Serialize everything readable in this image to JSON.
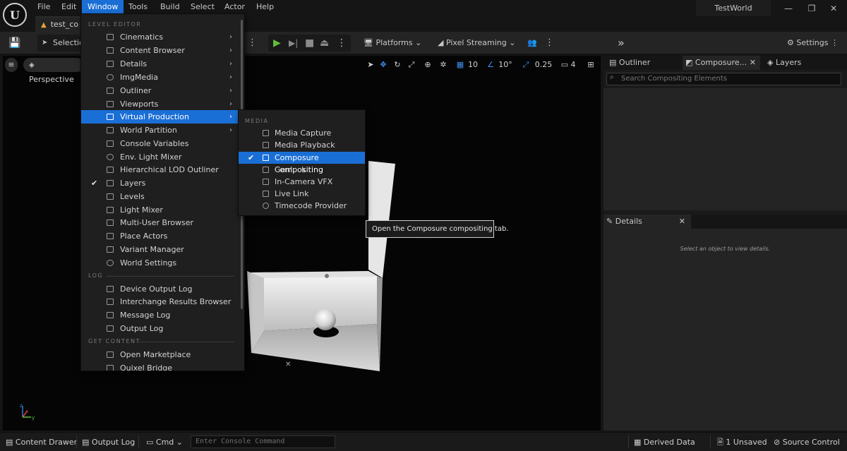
{
  "titlebar": {
    "logo": "U",
    "menus": [
      "File",
      "Edit",
      "Window",
      "Tools",
      "Build",
      "Select",
      "Actor",
      "Help"
    ],
    "active_menu": "Window",
    "doc_tab": "test_co",
    "world_title": "TestWorld"
  },
  "toolbar": {
    "selection_label": "Selectio",
    "platforms_label": "Platforms",
    "pixel_streaming_label": "Pixel Streaming",
    "settings_label": "Settings"
  },
  "viewport": {
    "perspective_label": "Perspective",
    "grid_snap": "10",
    "rotation_snap": "10°",
    "scale_snap": "0.25",
    "camera_speed": "4"
  },
  "window_menu": {
    "sections": {
      "level_editor": "LEVEL EDITOR",
      "log": "LOG",
      "get_content": "GET CONTENT"
    },
    "items": [
      {
        "label": "Cinematics",
        "submenu": true
      },
      {
        "label": "Content Browser",
        "submenu": true
      },
      {
        "label": "Details",
        "submenu": true
      },
      {
        "label": "ImgMedia",
        "submenu": true
      },
      {
        "label": "Outliner",
        "submenu": true
      },
      {
        "label": "Viewports",
        "submenu": true
      },
      {
        "label": "Virtual Production",
        "submenu": true,
        "highlighted": true
      },
      {
        "label": "World Partition",
        "submenu": true
      },
      {
        "label": "Console Variables"
      },
      {
        "label": "Env. Light Mixer"
      },
      {
        "label": "Hierarchical LOD Outliner"
      },
      {
        "label": "Layers",
        "checked": true
      },
      {
        "label": "Levels"
      },
      {
        "label": "Light Mixer"
      },
      {
        "label": "Multi-User Browser"
      },
      {
        "label": "Place Actors"
      },
      {
        "label": "Variant Manager"
      },
      {
        "label": "World Settings"
      }
    ],
    "log_items": [
      "Device Output Log",
      "Interchange Results Browser",
      "Message Log",
      "Output Log"
    ],
    "content_items": [
      "Open Marketplace",
      "Quixel Bridge"
    ]
  },
  "submenu": {
    "section": "MEDIA",
    "items": [
      {
        "label": "Media Capture"
      },
      {
        "label": "Media Playback"
      },
      {
        "label": "Composure Compositing",
        "checked": true,
        "highlighted": true
      },
      {
        "label": "Genlock"
      },
      {
        "label": "In-Camera VFX"
      },
      {
        "label": "Live Link"
      },
      {
        "label": "Timecode Provider"
      }
    ]
  },
  "tooltip": "Open the Composure compositing tab.",
  "right_panel": {
    "tabs": [
      "Outliner",
      "Composure...",
      "Layers"
    ],
    "active_tab": "Composure...",
    "search_placeholder": "Search Compositing Elements",
    "details_tab": "Details",
    "details_empty": "Select an object to view details."
  },
  "statusbar": {
    "content_drawer": "Content Drawer",
    "output_log": "Output Log",
    "cmd": "Cmd",
    "console_placeholder": "Enter Console Command",
    "derived_data": "Derived Data",
    "unsaved": "1 Unsaved",
    "source_control": "Source Control"
  },
  "colors": {
    "accent": "#1a6fd6",
    "play": "#5fbf3a",
    "warning": "#e8a23a"
  }
}
